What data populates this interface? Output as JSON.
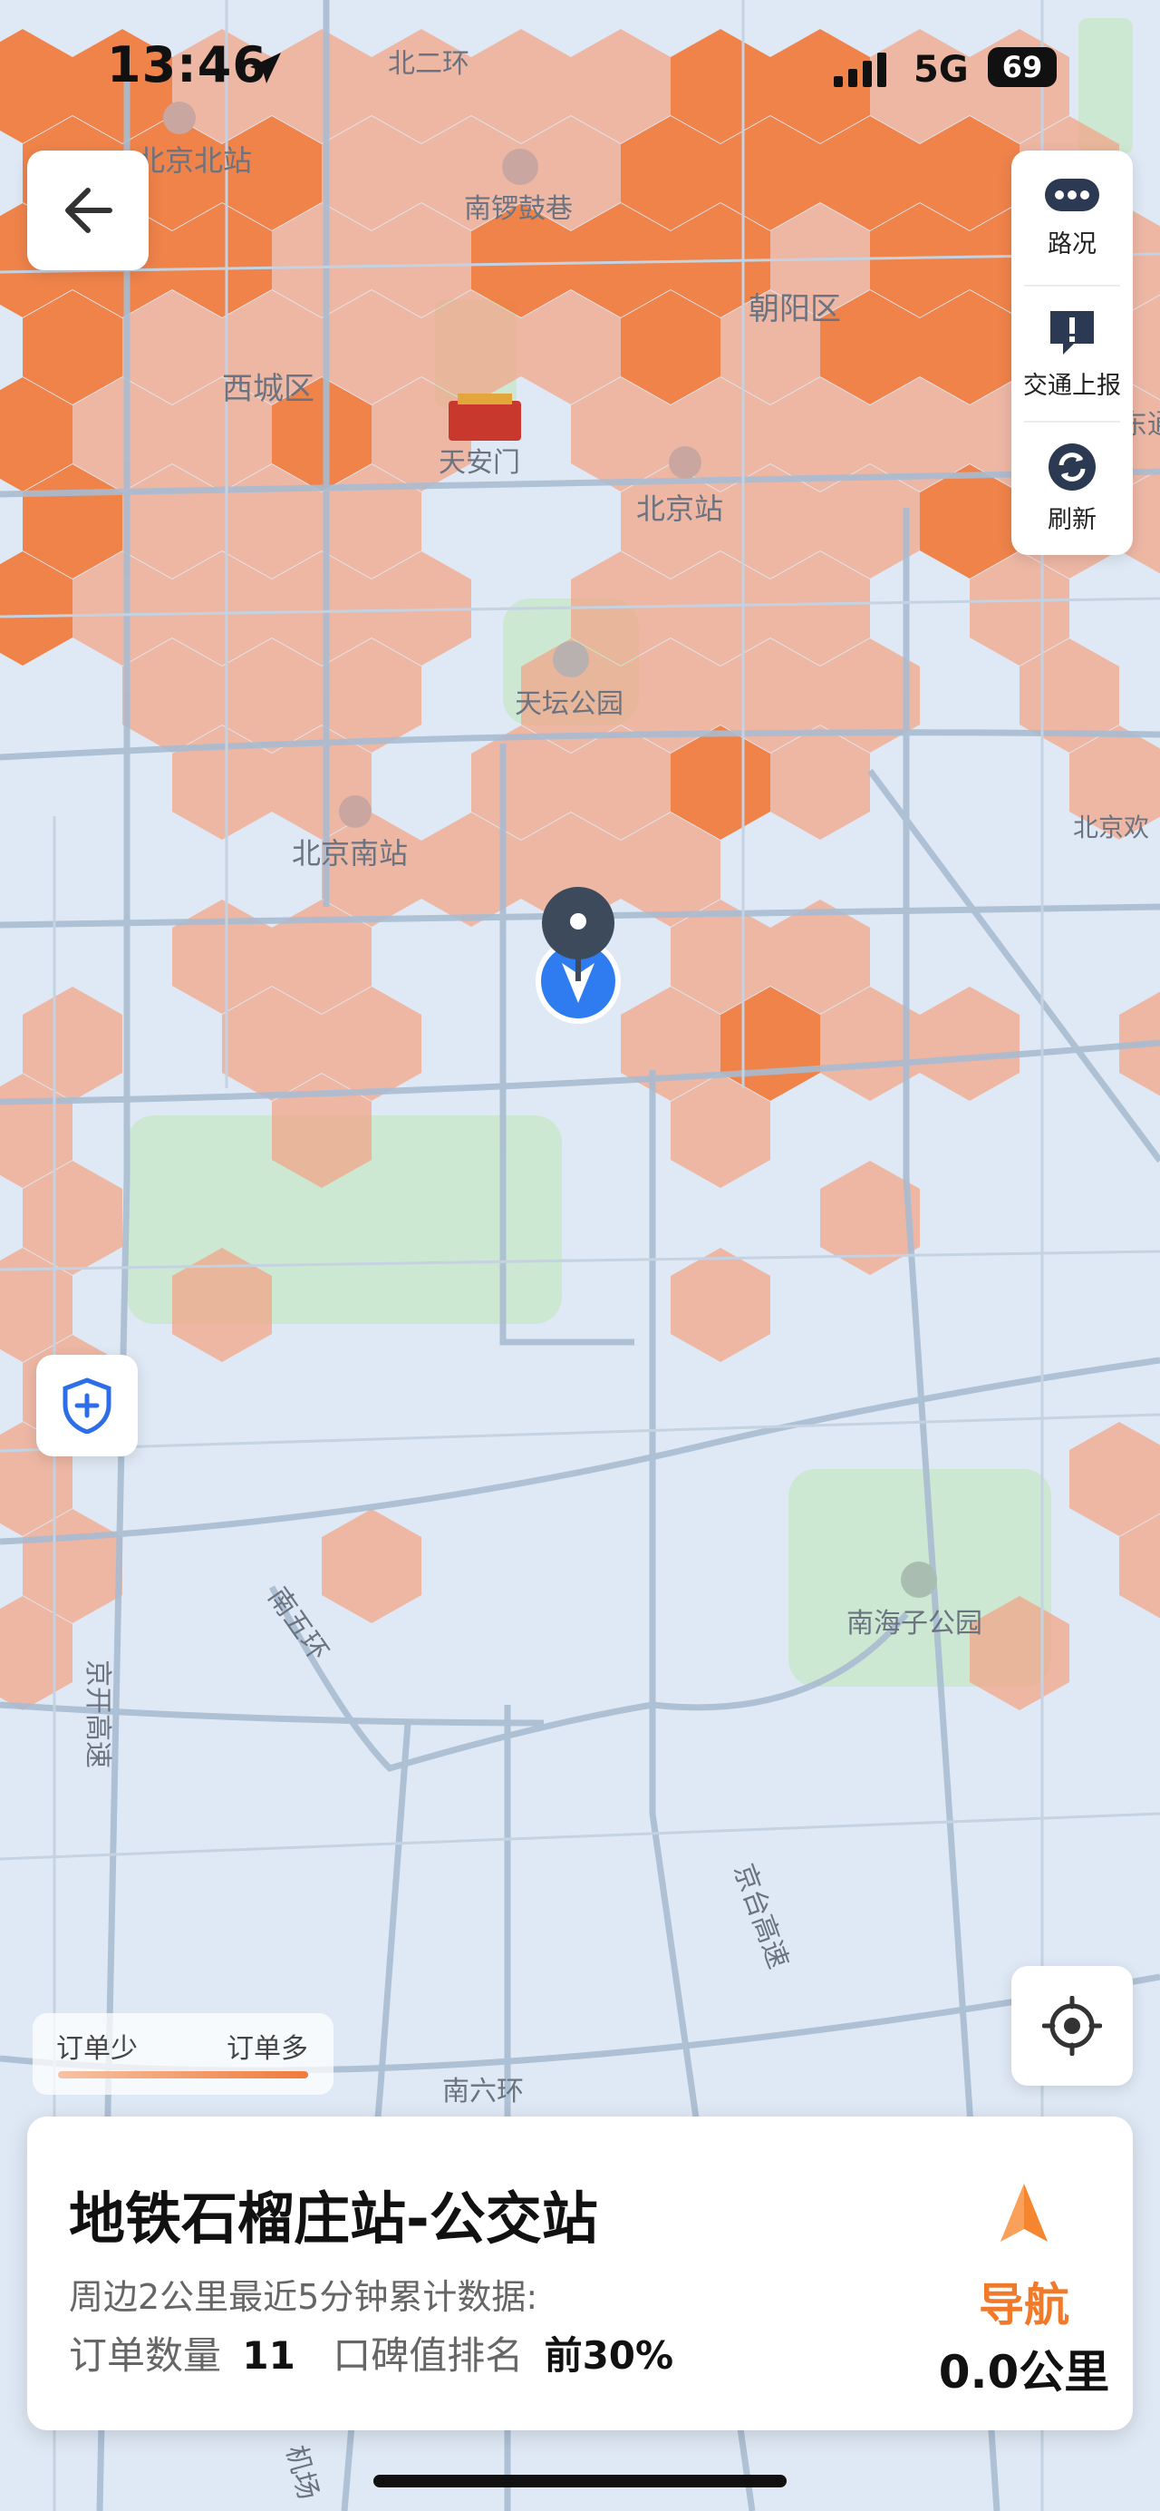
{
  "status_bar": {
    "time": "13:46",
    "network": "5G",
    "battery": "69"
  },
  "map": {
    "road_labels": [
      "北二环",
      "南五环",
      "京开高速",
      "京台高速",
      "南六环"
    ],
    "place_labels": {
      "beijing_north_station": "北京北站",
      "nanluoguxiang": "南锣鼓巷",
      "xicheng": "西城区",
      "chaoyang": "朝阳区",
      "tiananmen": "天安门",
      "beijing_station": "北京站",
      "temple_of_heaven": "天坛公园",
      "beijing_south_station": "北京南站",
      "beijing_huan": "北京欢",
      "nanhaizi_park": "南海子公园",
      "east_road_fragment": "东通",
      "airport_fragment": "机场"
    },
    "heat_colors": {
      "high": "#f07a3b",
      "low": "#f3a385"
    }
  },
  "controls": {
    "back": {
      "icon": "back-arrow-icon"
    },
    "traffic": {
      "label": "路况",
      "icon": "chat-bubble-icon"
    },
    "report": {
      "label": "交通上报",
      "icon": "alert-bubble-icon"
    },
    "refresh": {
      "label": "刷新",
      "icon": "refresh-icon"
    },
    "shield": {
      "icon": "shield-plus-icon"
    },
    "locate": {
      "icon": "locate-icon"
    }
  },
  "legend": {
    "low": "订单少",
    "high": "订单多"
  },
  "info_card": {
    "station": "地铁石榴庄站-公交站",
    "stats_line": "周边2公里最近5分钟累计数据:",
    "order_count_label": "订单数量",
    "order_count": "11",
    "rank_label": "口碑值排名",
    "rank": "前30%",
    "nav_label": "导航",
    "distance": "0.0公里",
    "accent": "#f07a2b"
  }
}
